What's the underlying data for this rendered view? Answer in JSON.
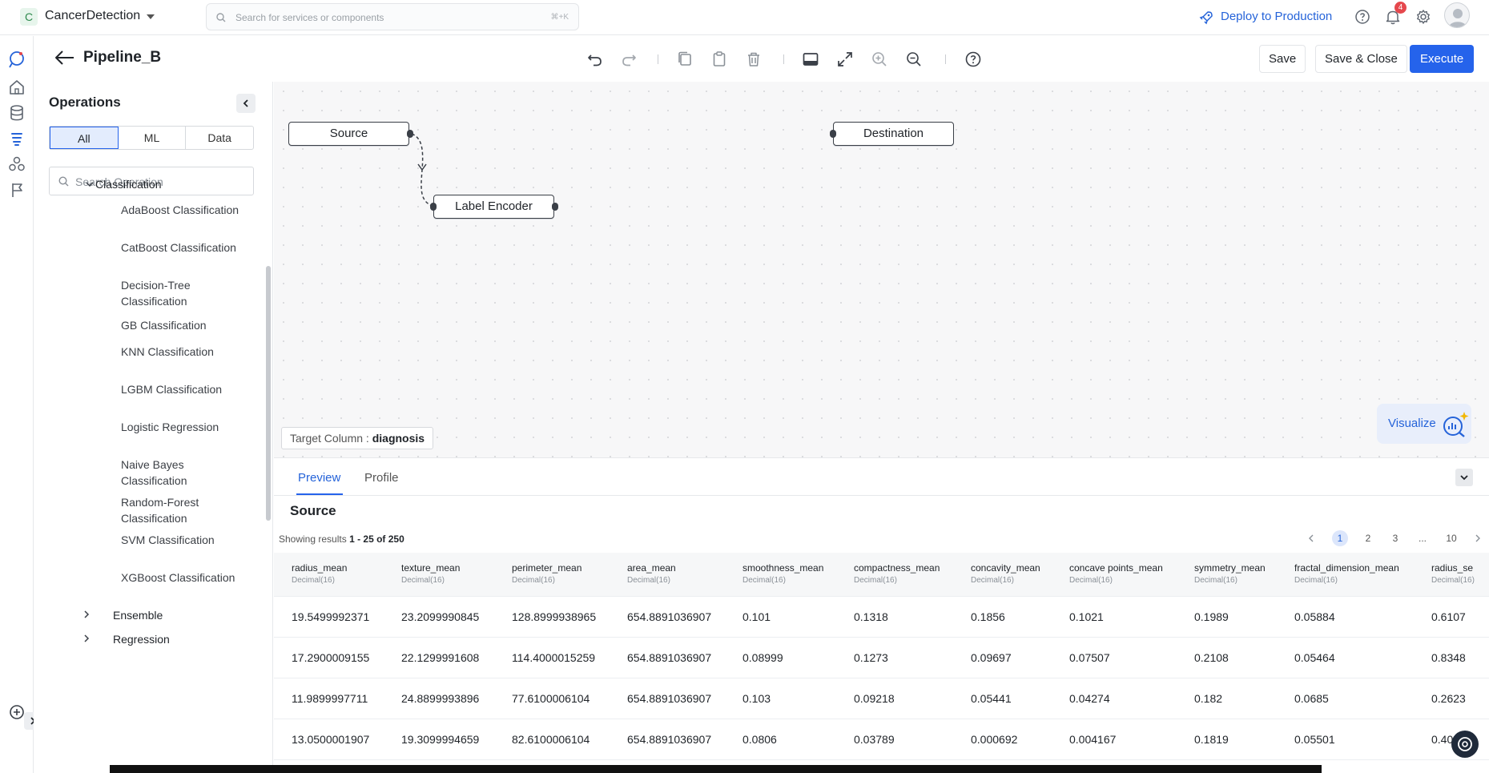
{
  "topbar": {
    "project_initial": "C",
    "project_name": "CancerDetection",
    "search_placeholder": "Search for services or components",
    "search_shortcut": "⌘+K",
    "deploy_label": "Deploy to Production",
    "notification_count": "4"
  },
  "header": {
    "pipeline_name": "Pipeline_B",
    "save_label": "Save",
    "save_close_label": "Save & Close",
    "execute_label": "Execute"
  },
  "operations": {
    "title": "Operations",
    "filters": [
      "All",
      "ML",
      "Data"
    ],
    "active_filter": "All",
    "search_placeholder": "Search Operation",
    "groups": [
      {
        "label": "Classification",
        "expanded": true,
        "items": [
          "AdaBoost Classification",
          "CatBoost Classification",
          "Decision-Tree Classification",
          "GB Classification",
          "KNN Classification",
          "LGBM Classification",
          "Logistic Regression",
          "Naive Bayes Classification",
          "Random-Forest Classification",
          "SVM Classification",
          "XGBoost Classification"
        ]
      },
      {
        "label": "Ensemble",
        "expanded": false
      },
      {
        "label": "Regression",
        "expanded": false
      }
    ]
  },
  "canvas": {
    "nodes": {
      "source": "Source",
      "label_encoder": "Label Encoder",
      "destination": "Destination"
    },
    "target_label": "Target Column :",
    "target_value": "diagnosis",
    "visualize_label": "Visualize"
  },
  "preview": {
    "tabs": [
      "Preview",
      "Profile"
    ],
    "active_tab": "Preview",
    "title": "Source",
    "showing_prefix": "Showing results",
    "showing_range": "1 - 25 of 250",
    "pages": [
      "1",
      "2",
      "3",
      "...",
      "10"
    ],
    "current_page": "1",
    "columns": [
      {
        "name": "radius_mean",
        "type": "Decimal(16)"
      },
      {
        "name": "texture_mean",
        "type": "Decimal(16)"
      },
      {
        "name": "perimeter_mean",
        "type": "Decimal(16)"
      },
      {
        "name": "area_mean",
        "type": "Decimal(16)"
      },
      {
        "name": "smoothness_mean",
        "type": "Decimal(16)"
      },
      {
        "name": "compactness_mean",
        "type": "Decimal(16)"
      },
      {
        "name": "concavity_mean",
        "type": "Decimal(16)"
      },
      {
        "name": "concave points_mean",
        "type": "Decimal(16)"
      },
      {
        "name": "symmetry_mean",
        "type": "Decimal(16)"
      },
      {
        "name": "fractal_dimension_mean",
        "type": "Decimal(16)"
      },
      {
        "name": "radius_se",
        "type": "Decimal(16)"
      }
    ],
    "rows": [
      [
        "19.5499992371",
        "23.2099990845",
        "128.8999938965",
        "654.8891036907",
        "0.101",
        "0.1318",
        "0.1856",
        "0.1021",
        "0.1989",
        "0.05884",
        "0.6107"
      ],
      [
        "17.2900009155",
        "22.1299991608",
        "114.4000015259",
        "654.8891036907",
        "0.08999",
        "0.1273",
        "0.09697",
        "0.07507",
        "0.2108",
        "0.05464",
        "0.8348"
      ],
      [
        "11.9899997711",
        "24.8899993896",
        "77.6100006104",
        "654.8891036907",
        "0.103",
        "0.09218",
        "0.05441",
        "0.04274",
        "0.182",
        "0.0685",
        "0.2623"
      ],
      [
        "13.0500001907",
        "19.3099994659",
        "82.6100006104",
        "654.8891036907",
        "0.0806",
        "0.03789",
        "0.000692",
        "0.004167",
        "0.1819",
        "0.05501",
        "0.40"
      ]
    ]
  },
  "colors": {
    "accent": "#2563eb",
    "badge": "#e5484d",
    "project_badge": "#e7f5ec"
  },
  "icons": [
    "search-icon",
    "rocket-icon",
    "help-icon",
    "bell-icon",
    "gear-icon",
    "avatar-icon",
    "undo-icon",
    "redo-icon",
    "copy-icon",
    "paste-icon",
    "trash-icon",
    "panel-icon",
    "expand-icon",
    "zoom-in-icon",
    "zoom-out-icon",
    "question-icon",
    "chevron-down-icon",
    "chevron-right-icon",
    "chevron-left-icon"
  ]
}
